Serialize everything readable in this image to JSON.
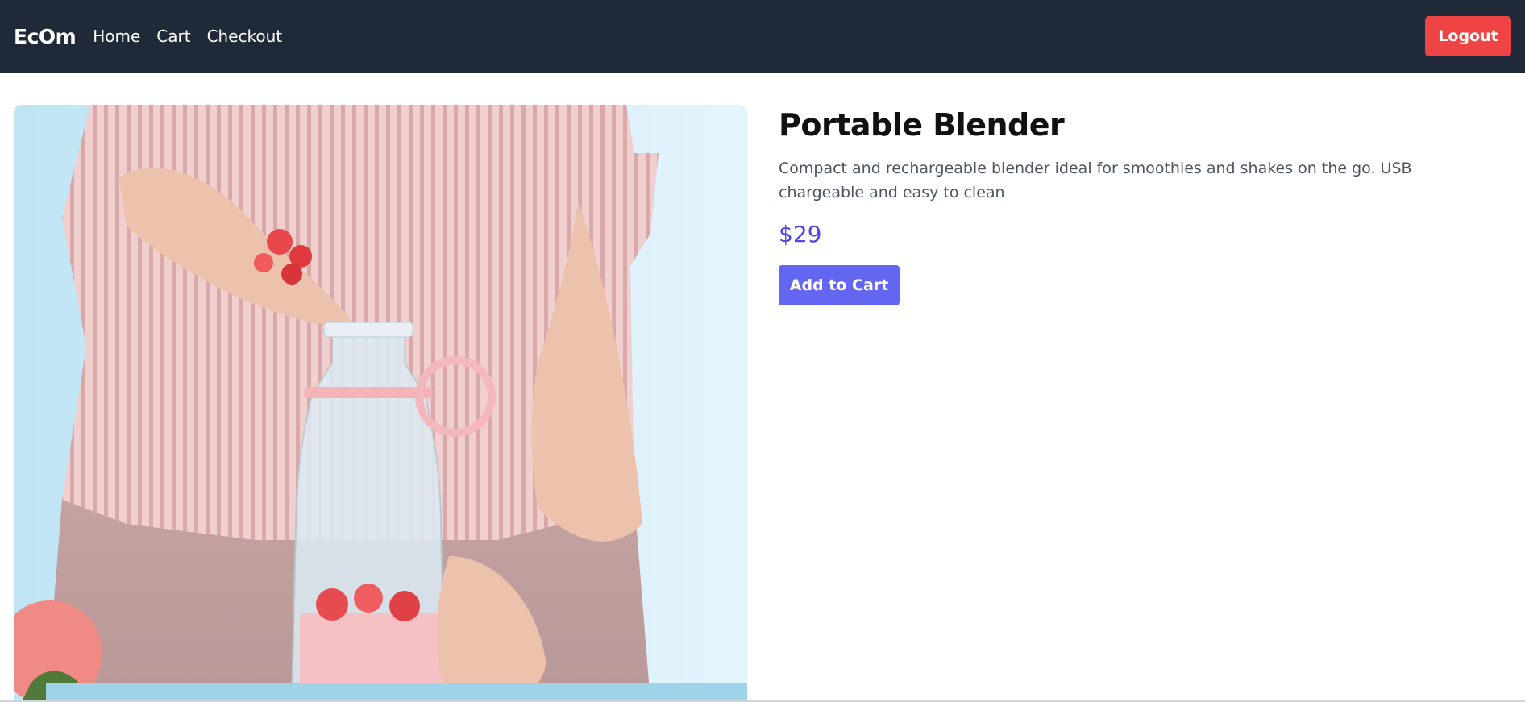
{
  "nav": {
    "brand": "EcOm",
    "links": [
      "Home",
      "Cart",
      "Checkout"
    ],
    "logout_label": "Logout"
  },
  "product": {
    "title": "Portable Blender",
    "description": "Compact and rechargeable blender ideal for smoothies and shakes on the go. USB chargeable and easy to clean",
    "price": "$29",
    "add_to_cart_label": "Add to Cart"
  },
  "colors": {
    "navbar_bg": "#1f2937",
    "logout": "#ef4444",
    "accent": "#6366f1",
    "price": "#4f46e5"
  }
}
